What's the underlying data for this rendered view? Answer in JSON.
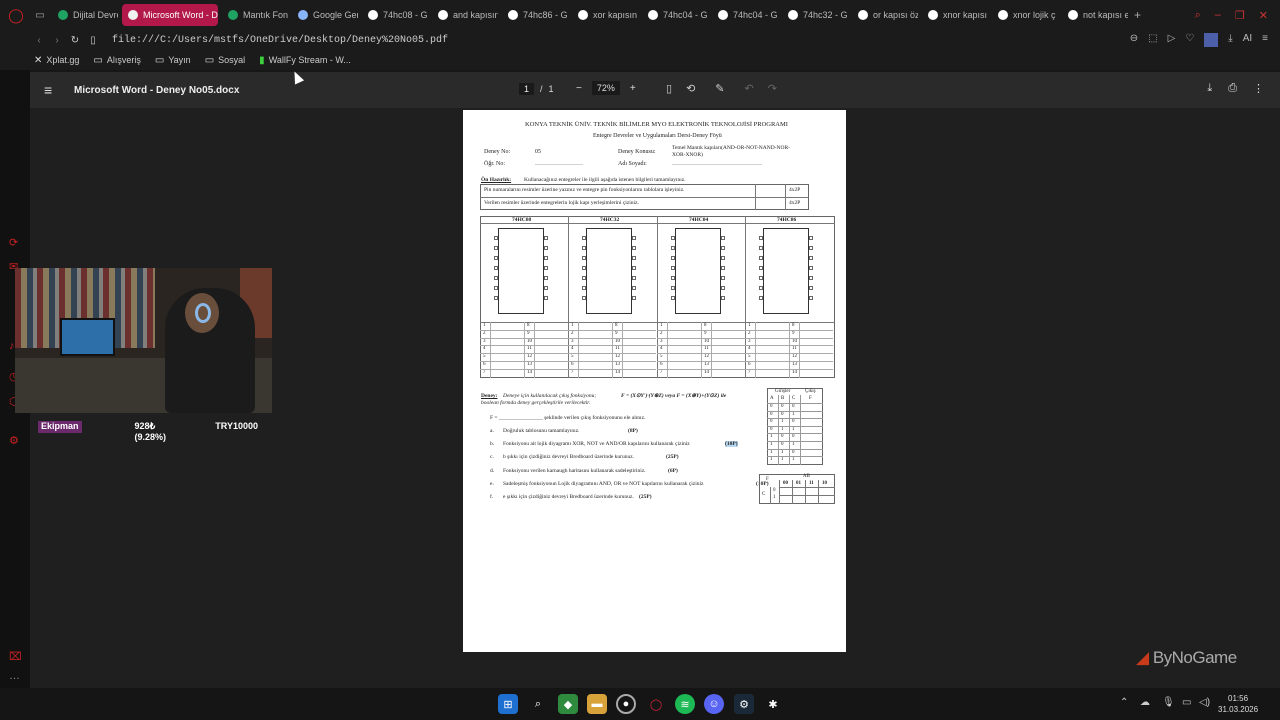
{
  "browser": {
    "tabs": [
      {
        "label": "Dijital Devre",
        "fav": "#1ea362",
        "active": false
      },
      {
        "label": "Microsoft Word - De",
        "fav": "#f0f0f0",
        "active": true
      },
      {
        "label": "Mantık Fon",
        "fav": "#1ea362",
        "active": false
      },
      {
        "label": "Google Gem",
        "fav": "#8ab4f8",
        "active": false
      },
      {
        "label": "74hc08 - G",
        "fav": "#ffffff",
        "active": false
      },
      {
        "label": "and kapısın",
        "fav": "#ffffff",
        "active": false
      },
      {
        "label": "74hc86 - G",
        "fav": "#ffffff",
        "active": false
      },
      {
        "label": "xor kapısın",
        "fav": "#ffffff",
        "active": false
      },
      {
        "label": "74hc04 - G",
        "fav": "#ffffff",
        "active": false
      },
      {
        "label": "74hc04 - G",
        "fav": "#ffffff",
        "active": false
      },
      {
        "label": "74hc32 - G",
        "fav": "#ffffff",
        "active": false
      },
      {
        "label": "or kapısı öz",
        "fav": "#ffffff",
        "active": false
      },
      {
        "label": "xnor kapısı",
        "fav": "#ffffff",
        "active": false
      },
      {
        "label": "xnor lojik ç",
        "fav": "#ffffff",
        "active": false
      },
      {
        "label": "not kapısı e",
        "fav": "#ffffff",
        "active": false
      }
    ],
    "new_tab": "+",
    "url": "file:///C:/Users/mstfs/OneDrive/Desktop/Deney%20No05.pdf",
    "ai_label": "AI",
    "bookmarks": [
      {
        "label": "Xplat.gg",
        "icon": "x-icon"
      },
      {
        "label": "Alışveriş",
        "icon": "folder-icon"
      },
      {
        "label": "Yayın",
        "icon": "folder-icon"
      },
      {
        "label": "Sosyal",
        "icon": "folder-icon"
      },
      {
        "label": "WallFy Stream - W...",
        "icon": "wallfy-icon"
      }
    ]
  },
  "viewer": {
    "title": "Microsoft Word - Deney No05.docx",
    "page_current": "1",
    "page_sep": "/",
    "page_total": "1",
    "zoom": "72%"
  },
  "document": {
    "header1": "KONYA TEKNİK ÜNİV. TEKNİK BİLİMLER MYO ELEKTRONİK TEKNOLOJİSİ PROGRAMI",
    "header2": "Entegre Devreler ve Uygulamaları Dersi-Deney Föyü",
    "deney_no_label": "Deney No:",
    "deney_no_value": "05",
    "konusu_label": "Deney Konusu:",
    "konusu_value1": "Temel Mantık kapıları(AND-OR-NOT-NAND-NOR-",
    "konusu_value2": "XOR-XNOR)",
    "ogr_label": "Öğr. No:",
    "ogr_dots": "……………………",
    "ad_label": "Adı Soyadı:",
    "ad_dots": "………………………………………",
    "on_title": "Ön Hazırlık:",
    "on_text": "Kullanacağınız entegreler ile ilgili aşağıda istenen bilgileri tamamlayınız.",
    "row1": "Pin numaralarını resimler üzerine yazınız ve entegre pin fonksiyonlarını tablolara işleyiniz.",
    "row1_pts": "4x2P",
    "row2": "Verilen resimler üzerinde entegrelerin lojik kapı yerleşimlerini çiziniz.",
    "row2_pts": "4x2P",
    "chips": [
      "74HC08",
      "74HC32",
      "74HC04",
      "74HC86"
    ],
    "deney_title": "Deney:",
    "deney_text1": "Deneye için kullanılacak çıkış fonksiyonu;",
    "deney_formula": "F = (X⊙Y')·(Y⊕Z) veya F = (X⊕Y)+(Y⊙Z) ile",
    "deney_text2": "boolean formda deney gerçekleştirile verilecektir.",
    "f_line": "F = ________________ şeklinde verilen çıkış fonksiyonunu ele alınız.",
    "items": [
      {
        "k": "a.",
        "t": "Doğruluk tablosunu tamamlayınız.",
        "p": "(8P)"
      },
      {
        "k": "b.",
        "t": "Fonksiyonu ait lojik diyagramı XOR, NOT ve AND/OR kapılarını kullanarak çiziniz",
        "p": "(10P)"
      },
      {
        "k": "c.",
        "t": "b şıkkı için çizdiğiniz devreyi Bredboard üzerinde kurunuz.",
        "p": "(25P)"
      },
      {
        "k": "d.",
        "t": "Fonksiyonu verilen karnaugh haritasını kullanarak sadeleştiriniz.",
        "p": "(6P)"
      },
      {
        "k": "e.",
        "t": "Sadeleşmiş fonksiyonun Lojik diyagramını AND, OR ve NOT kapılarını kullanarak çiziniz",
        "p": "(10P)"
      },
      {
        "k": "f.",
        "t": "e şıkkı için çizdiğiniz devreyi Bredboard üzerinde kurunuz.",
        "p": "(25P)"
      }
    ],
    "truth_head_inputs": "Girişler",
    "truth_head_output": "Çıkış",
    "truth_cols": [
      "A",
      "B",
      "C",
      "F"
    ],
    "truth_rows": [
      [
        "0",
        "0",
        "0"
      ],
      [
        "0",
        "0",
        "1"
      ],
      [
        "0",
        "1",
        "0"
      ],
      [
        "0",
        "1",
        "1"
      ],
      [
        "1",
        "0",
        "0"
      ],
      [
        "1",
        "0",
        "1"
      ],
      [
        "1",
        "1",
        "0"
      ],
      [
        "1",
        "1",
        "1"
      ]
    ],
    "kmap_f": "F",
    "kmap_ab": "AB",
    "kmap_cols": [
      "00",
      "01",
      "11",
      "10"
    ],
    "kmap_c": "C",
    "kmap_rows": [
      "0",
      "1"
    ]
  },
  "stream": {
    "hud_label": "Ekipman",
    "hud_value1": "928₺ (9.28%)",
    "hud_value2": "TRY10000",
    "watermark": "ByNoGame"
  },
  "taskbar": {
    "time": "01:56",
    "date": "31.03.2026"
  }
}
